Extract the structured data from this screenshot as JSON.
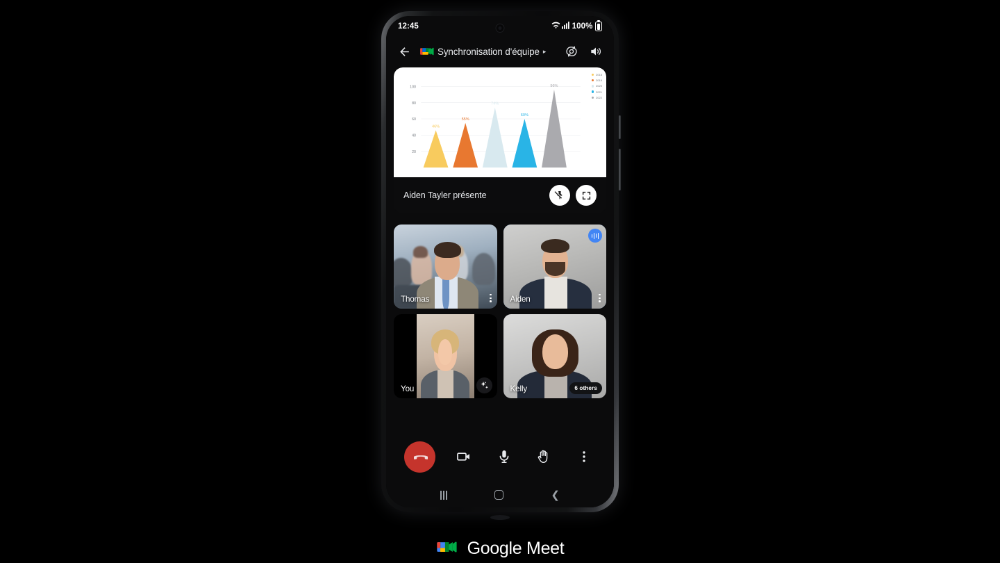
{
  "status_bar": {
    "time": "12:45",
    "battery_percent": "100%",
    "wifi_icon": "wifi-icon",
    "signal_icon": "cellular-signal-icon",
    "battery_icon": "battery-full-icon"
  },
  "app_bar": {
    "back_icon": "back-arrow-icon",
    "logo_icon": "google-meet-logo-icon",
    "meeting_title": "Synchronisation d'équipe",
    "title_caret": "▸",
    "switch_camera_icon": "switch-camera-icon",
    "speaker_icon": "speaker-volume-icon"
  },
  "presentation": {
    "presenter_text": "Aiden Tayler présente",
    "unpin_icon": "unpin-icon",
    "fullscreen_icon": "fullscreen-icon"
  },
  "chart_data": {
    "type": "bar",
    "title": "",
    "subtitle": "",
    "xlabel": "",
    "ylabel": "",
    "categories": [
      "2018",
      "2019",
      "2020",
      "2021",
      "2022"
    ],
    "values": [
      46,
      55,
      74,
      60,
      96
    ],
    "data_labels": [
      "46%",
      "55%",
      "74%",
      "60%",
      "96%"
    ],
    "colors": [
      "#F8CB5E",
      "#E87830",
      "#D8E9EF",
      "#29B4E6",
      "#AAAAAE"
    ],
    "ylim": [
      0,
      108
    ],
    "yticks": [
      20,
      40,
      60,
      80,
      100
    ],
    "ytick_labels": [
      "20",
      "40",
      "60",
      "80",
      "100"
    ],
    "grid": true,
    "legend_position": "top-right",
    "legend": [
      {
        "label": "2018",
        "color": "#F8CB5E"
      },
      {
        "label": "2019",
        "color": "#E87830"
      },
      {
        "label": "2020",
        "color": "#D8E9EF"
      },
      {
        "label": "2021",
        "color": "#29B4E6"
      },
      {
        "label": "2022",
        "color": "#AAAAAE"
      }
    ],
    "marker_shape": "triangle",
    "background": "#ffffff"
  },
  "tiles": [
    {
      "name": "Thomas",
      "active_speaker": false,
      "menu_icon": "more-options-icon",
      "badge": null
    },
    {
      "name": "Aiden",
      "active_speaker": true,
      "menu_icon": "more-options-icon",
      "badge": "audio-activity-icon"
    },
    {
      "name": "You",
      "active_speaker": false,
      "menu_icon": null,
      "badge": "visual-effects-icon"
    },
    {
      "name": "Kelly",
      "active_speaker": false,
      "menu_icon": null,
      "badge": "6 others"
    }
  ],
  "controls": [
    {
      "name": "end-call",
      "icon": "phone-hangup-icon",
      "label": ""
    },
    {
      "name": "camera",
      "icon": "video-camera-icon",
      "label": ""
    },
    {
      "name": "microphone",
      "icon": "microphone-icon",
      "label": ""
    },
    {
      "name": "raise-hand",
      "icon": "raise-hand-icon",
      "label": ""
    },
    {
      "name": "more",
      "icon": "more-vertical-icon",
      "label": ""
    }
  ],
  "nav_bar": {
    "recents_icon": "recents-icon",
    "home_icon": "home-icon",
    "back_icon": "back-icon"
  },
  "branding": {
    "logo_icon": "google-meet-logo-icon",
    "text": "Google Meet"
  },
  "theme": {
    "accent_blue": "#4285f4",
    "active_border": "#67a9f5",
    "end_call_red": "#c5342c",
    "screen_bg": "#0b0b0c",
    "text_primary": "#e8eaed"
  }
}
